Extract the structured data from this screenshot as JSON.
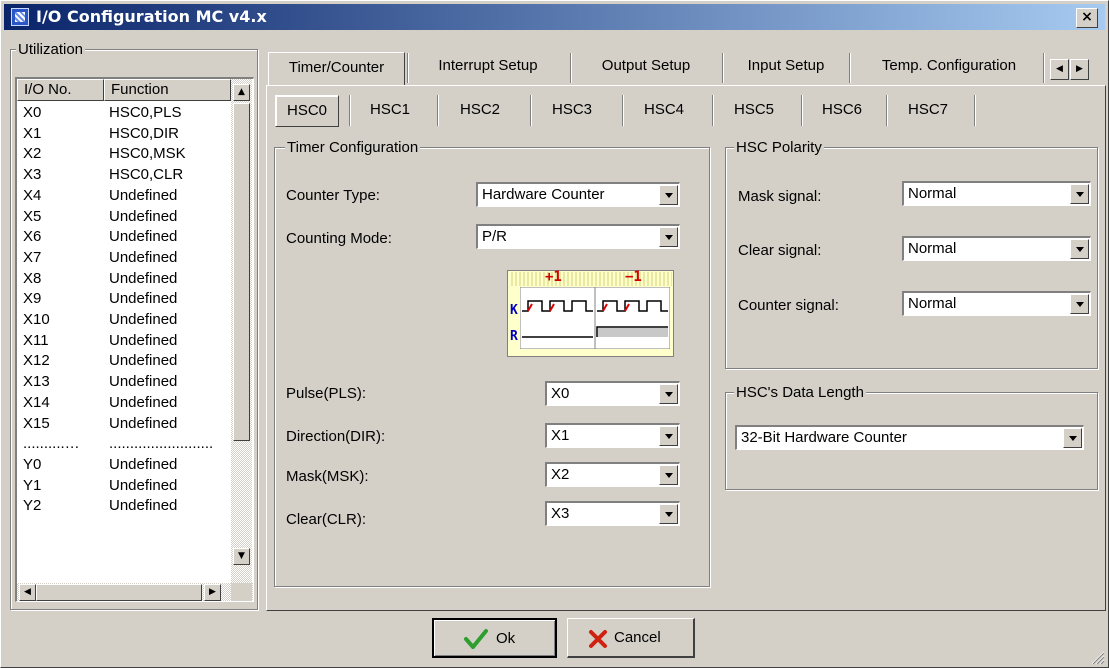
{
  "window": {
    "title": "I/O Configuration MC v4.x",
    "close_glyph": "×"
  },
  "utilization": {
    "label": "Utilization",
    "columns": [
      "I/O No.",
      "Function"
    ],
    "rows": [
      [
        "X0",
        "HSC0,PLS"
      ],
      [
        "X1",
        "HSC0,DIR"
      ],
      [
        "X2",
        "HSC0,MSK"
      ],
      [
        "X3",
        "HSC0,CLR"
      ],
      [
        "X4",
        "Undefined"
      ],
      [
        "X5",
        "Undefined"
      ],
      [
        "X6",
        "Undefined"
      ],
      [
        "X7",
        "Undefined"
      ],
      [
        "X8",
        "Undefined"
      ],
      [
        "X9",
        "Undefined"
      ],
      [
        "X10",
        "Undefined"
      ],
      [
        "X11",
        "Undefined"
      ],
      [
        "X12",
        "Undefined"
      ],
      [
        "X13",
        "Undefined"
      ],
      [
        "X14",
        "Undefined"
      ],
      [
        "X15",
        "Undefined"
      ],
      [
        "..........…",
        "........................."
      ],
      [
        "Y0",
        "Undefined"
      ],
      [
        "Y1",
        "Undefined"
      ],
      [
        "Y2",
        "Undefined"
      ]
    ]
  },
  "tabs": [
    "Timer/Counter",
    "Interrupt Setup",
    "Output Setup",
    "Input Setup",
    "Temp. Configuration"
  ],
  "hsc_tabs": [
    "HSC0",
    "HSC1",
    "HSC2",
    "HSC3",
    "HSC4",
    "HSC5",
    "HSC6",
    "HSC7"
  ],
  "timer_config": {
    "label": "Timer Configuration",
    "counter_type": {
      "label": "Counter Type:",
      "value": "Hardware Counter"
    },
    "counting_mode": {
      "label": "Counting Mode:",
      "value": "P/R"
    },
    "diagram": {
      "plus": "+1",
      "minus": "−1",
      "k": "K",
      "r": "R"
    },
    "pulse": {
      "label": "Pulse(PLS):",
      "value": "X0"
    },
    "direction": {
      "label": "Direction(DIR):",
      "value": "X1"
    },
    "mask": {
      "label": "Mask(MSK):",
      "value": "X2"
    },
    "clear": {
      "label": "Clear(CLR):",
      "value": "X3"
    }
  },
  "hsc_polarity": {
    "label": "HSC Polarity",
    "mask": {
      "label": "Mask signal:",
      "value": "Normal"
    },
    "clear": {
      "label": "Clear signal:",
      "value": "Normal"
    },
    "counter": {
      "label": "Counter signal:",
      "value": "Normal"
    }
  },
  "hsc_data_length": {
    "label": "HSC's Data Length",
    "value": "32-Bit Hardware Counter"
  },
  "buttons": {
    "ok": "Ok",
    "cancel": "Cancel"
  },
  "colors": {
    "title_start": "#0a246a",
    "title_end": "#a6caf0",
    "face": "#d4d0c8",
    "ok_check": "#2e9e2e",
    "cancel_x": "#d02010",
    "diagram_bg": "#ffffcc",
    "diagram_label": "#d00000"
  },
  "icons": {
    "app": "app-icon",
    "close": "close-icon",
    "ok": "checkmark-icon",
    "cancel": "x-icon",
    "scroll_up": "arrow-up-icon",
    "scroll_down": "arrow-down-icon",
    "scroll_left": "arrow-left-icon",
    "scroll_right": "arrow-right-icon"
  }
}
